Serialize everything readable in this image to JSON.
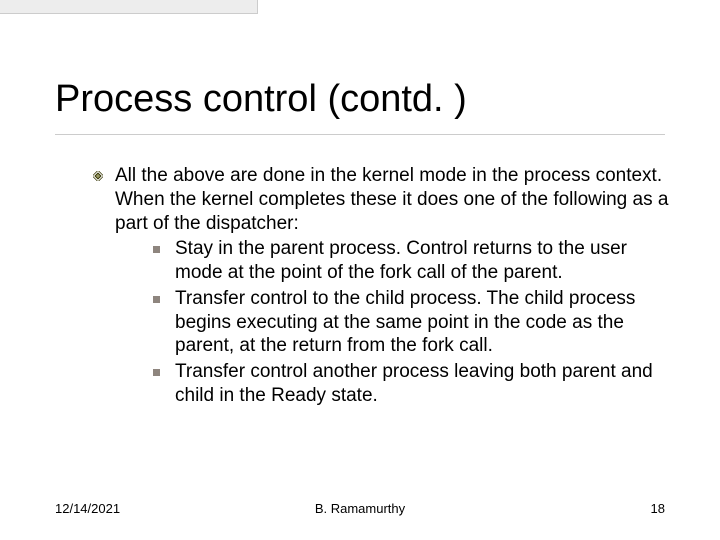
{
  "title": "Process control (contd. )",
  "intro": "All the above are done in the kernel mode in the process context. When the kernel completes these it does one of the following as a part of the dispatcher:",
  "subs": [
    "Stay in the parent process. Control returns to the user mode at the point of the fork call of the parent.",
    "Transfer control to the child process. The child process begins executing at the same point in the code as the parent, at the return from the fork call.",
    "Transfer control another process leaving both parent and child in the Ready state."
  ],
  "footer": {
    "date": "12/14/2021",
    "author": "B. Ramamurthy",
    "page": "18"
  }
}
